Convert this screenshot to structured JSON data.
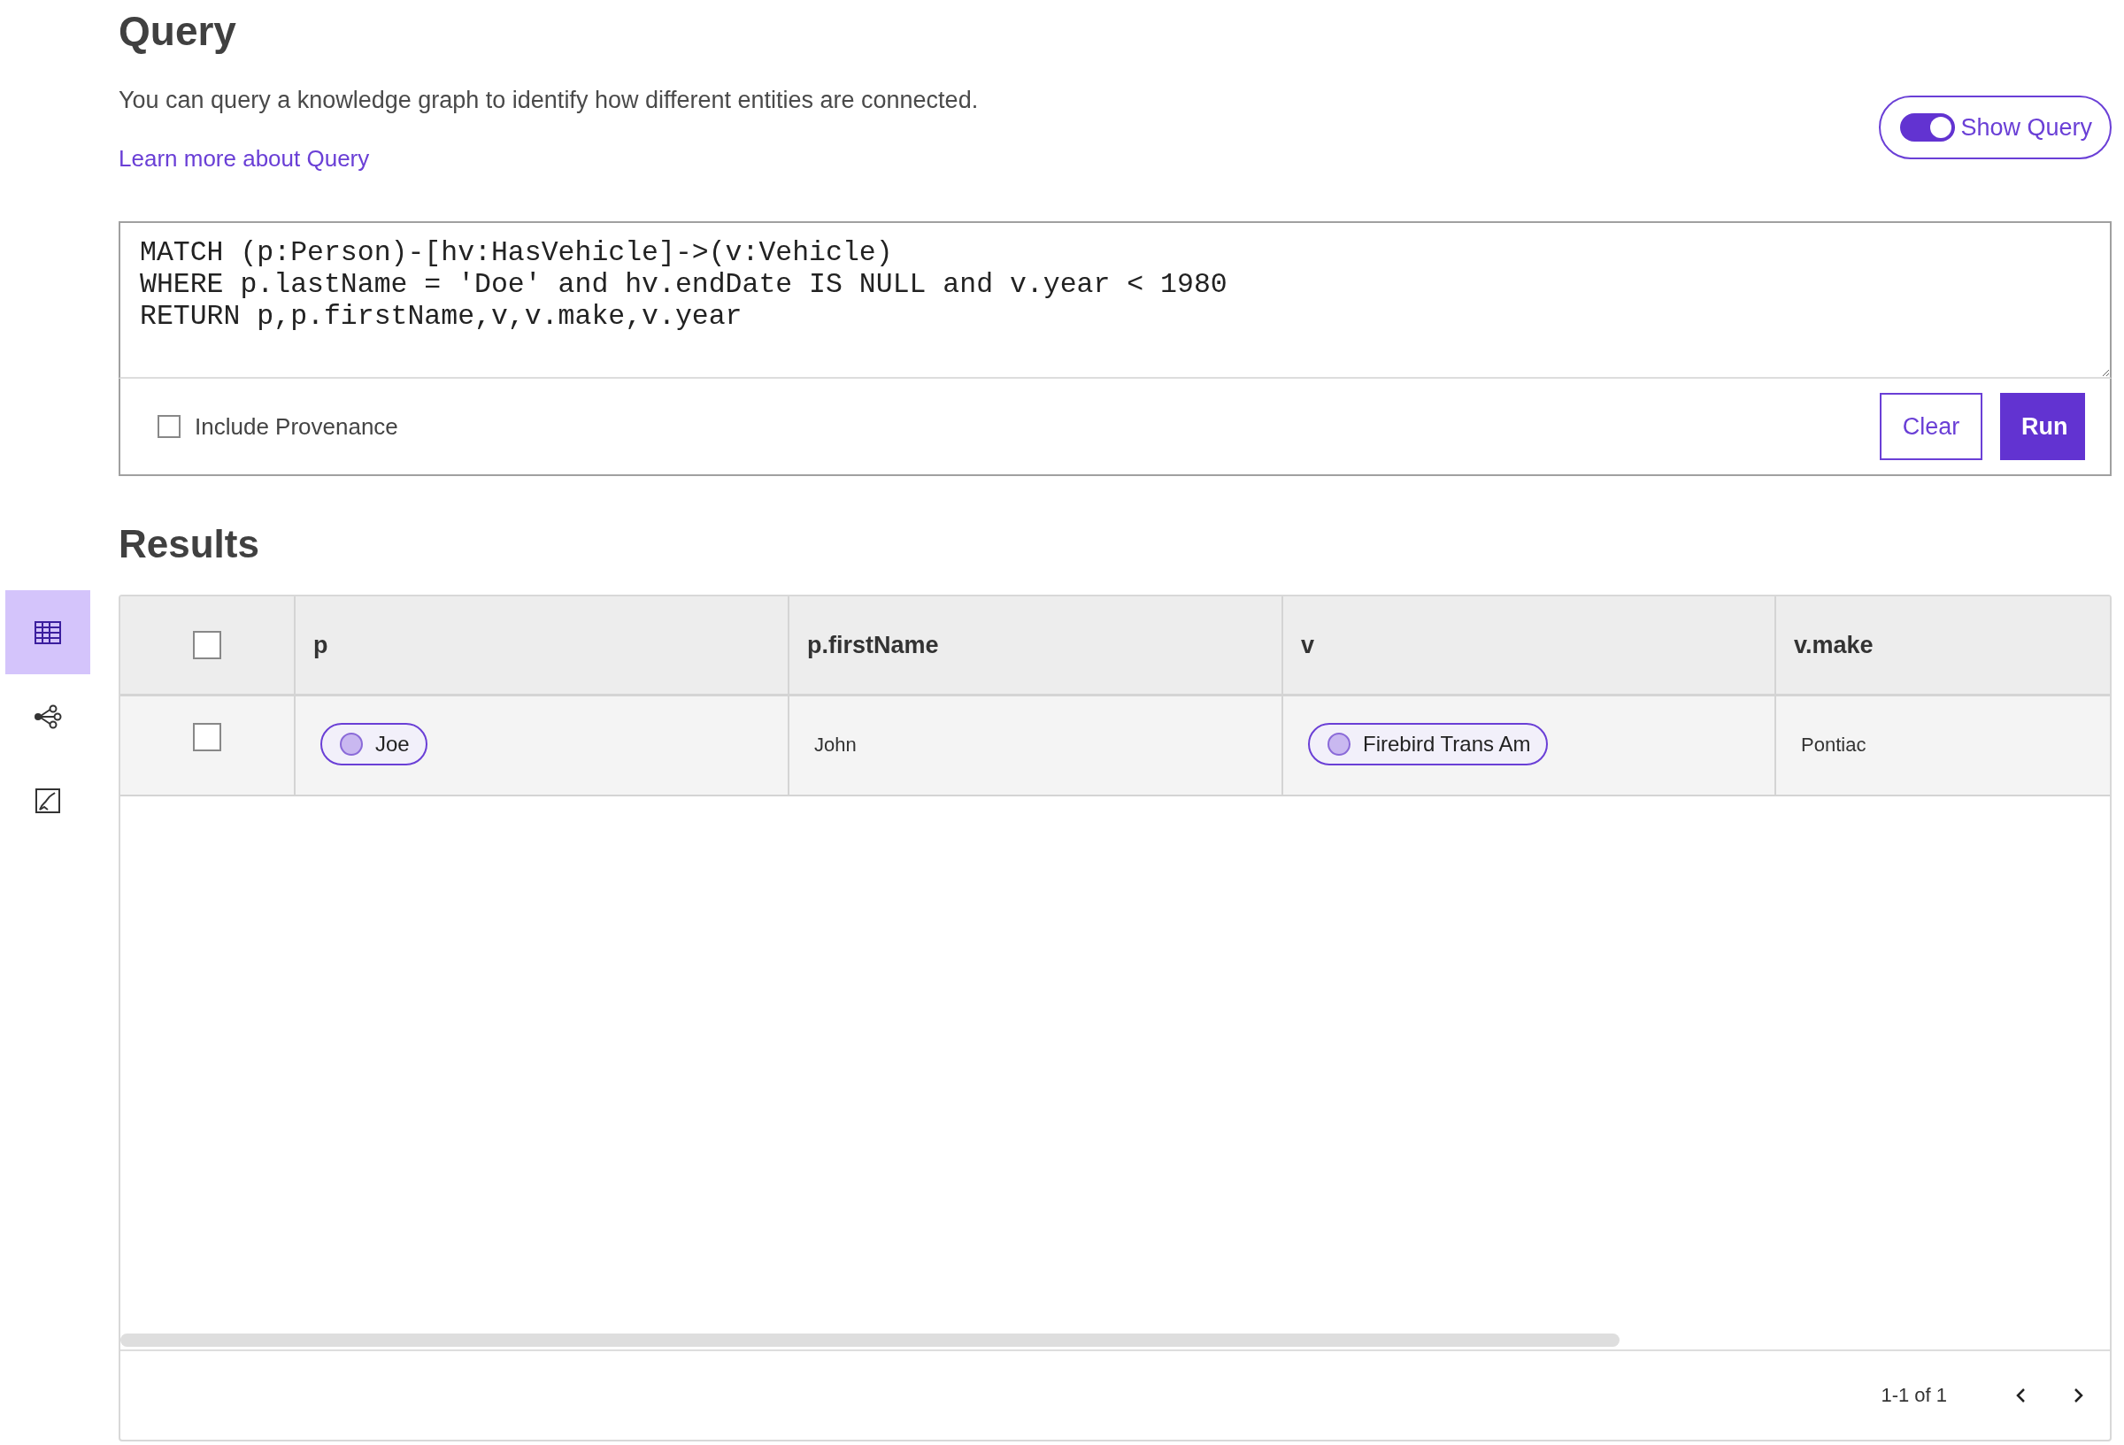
{
  "sidebar": {
    "items": [
      {
        "kind": "table",
        "selected": true
      },
      {
        "kind": "graph",
        "selected": false
      },
      {
        "kind": "chart",
        "selected": false
      }
    ]
  },
  "header": {
    "title": "Query",
    "description": "You can query a knowledge graph to identify how different entities are connected.",
    "link": "Learn more about Query"
  },
  "show_query_toggle": {
    "label": "Show Query",
    "on": true
  },
  "query": {
    "value": "MATCH (p:Person)-[hv:HasVehicle]->(v:Vehicle)\nWHERE p.lastName = 'Doe' and hv.endDate IS NULL and v.year < 1980\nRETURN p,p.firstName,v,v.make,v.year"
  },
  "include_provenance": {
    "label": "Include Provenance",
    "checked": false
  },
  "buttons": [
    {
      "label": "Clear",
      "kind": "secondary"
    },
    {
      "label": "Run",
      "kind": "primary"
    }
  ],
  "results": {
    "title": "Results",
    "select_all_checked": false,
    "columns": [
      "p",
      "p.firstName",
      "v",
      "v.make"
    ],
    "rows": [
      {
        "checked": false,
        "cells": [
          {
            "kind": "entity",
            "text": "Joe"
          },
          {
            "kind": "text",
            "text": "John"
          },
          {
            "kind": "entity",
            "text": "Firebird Trans Am"
          },
          {
            "kind": "text",
            "text": "Pontiac"
          }
        ]
      }
    ],
    "pagination": "1-1 of 1"
  }
}
